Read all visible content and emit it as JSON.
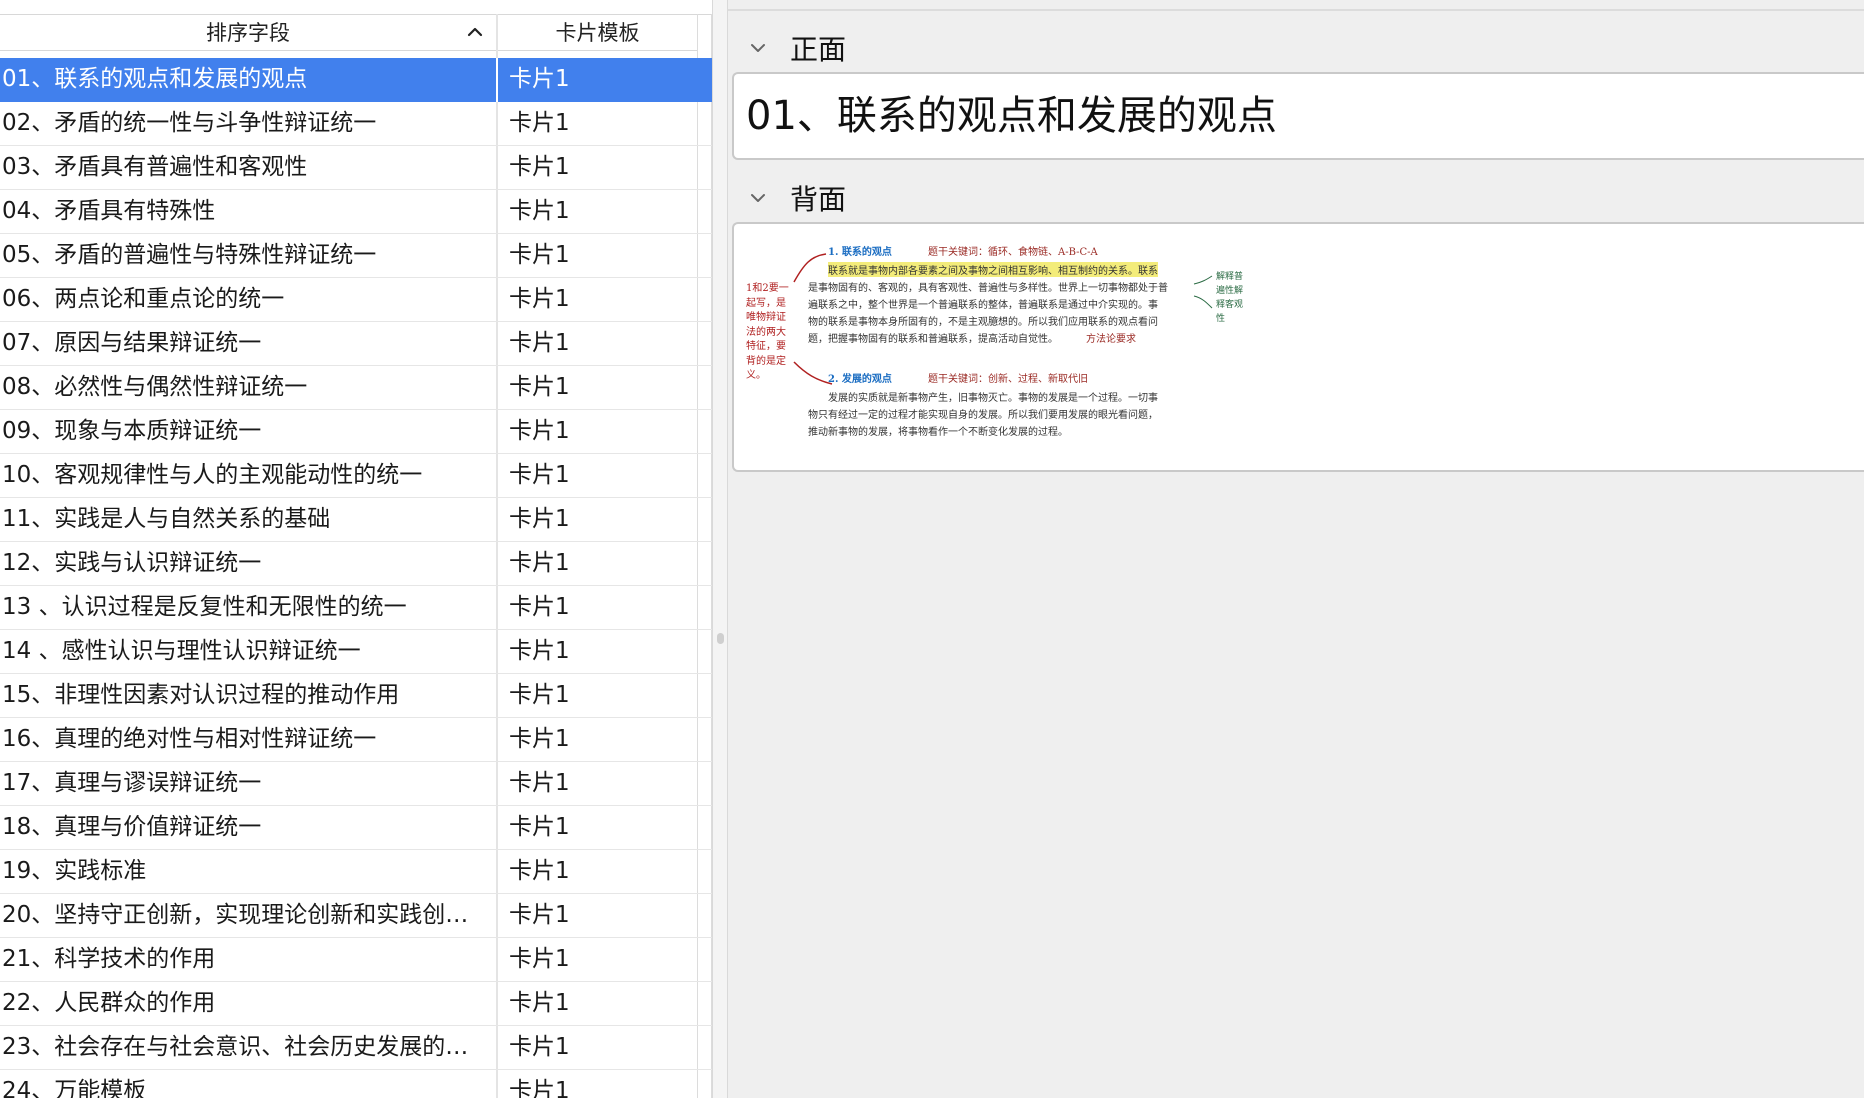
{
  "table": {
    "headers": {
      "sort_field": "排序字段",
      "card_template": "卡片模板"
    },
    "selected_index": 0,
    "rows": [
      {
        "title": "01、联系的观点和发展的观点",
        "template": "卡片1"
      },
      {
        "title": "02、矛盾的统一性与斗争性辩证统一",
        "template": "卡片1"
      },
      {
        "title": "03、矛盾具有普遍性和客观性",
        "template": "卡片1"
      },
      {
        "title": "04、矛盾具有特殊性",
        "template": "卡片1"
      },
      {
        "title": "05、矛盾的普遍性与特殊性辩证统一",
        "template": "卡片1"
      },
      {
        "title": "06、两点论和重点论的统一",
        "template": "卡片1"
      },
      {
        "title": "07、原因与结果辩证统一",
        "template": "卡片1"
      },
      {
        "title": "08、必然性与偶然性辩证统一",
        "template": "卡片1"
      },
      {
        "title": "09、现象与本质辩证统一",
        "template": "卡片1"
      },
      {
        "title": "10、客观规律性与人的主观能动性的统一",
        "template": "卡片1"
      },
      {
        "title": "11、实践是人与自然关系的基础",
        "template": "卡片1"
      },
      {
        "title": "12、实践与认识辩证统一",
        "template": "卡片1"
      },
      {
        "title": "13 、认识过程是反复性和无限性的统一",
        "template": "卡片1"
      },
      {
        "title": "14 、感性认识与理性认识辩证统一",
        "template": "卡片1"
      },
      {
        "title": "15、非理性因素对认识过程的推动作用",
        "template": "卡片1"
      },
      {
        "title": "16、真理的绝对性与相对性辩证统一",
        "template": "卡片1"
      },
      {
        "title": "17、真理与谬误辩证统一",
        "template": "卡片1"
      },
      {
        "title": "18、真理与价值辩证统一",
        "template": "卡片1"
      },
      {
        "title": "19、实践标准",
        "template": "卡片1"
      },
      {
        "title": "20、坚持守正创新，实现理论创新和实践创…",
        "template": "卡片1"
      },
      {
        "title": "21、科学技术的作用",
        "template": "卡片1"
      },
      {
        "title": "22、人民群众的作用",
        "template": "卡片1"
      },
      {
        "title": "23、社会存在与社会意识、社会历史发展的…",
        "template": "卡片1"
      },
      {
        "title": "24、万能模板",
        "template": "卡片1"
      }
    ]
  },
  "editor": {
    "front_label": "正面",
    "front_text": "01、联系的观点和发展的观点",
    "back_label": "背面",
    "back_note": {
      "heading1": "1. 联系的观点",
      "keywords1": "题干关键词：循环、食物链、A-B-C-A",
      "lines1": [
        "联系就是事物内部各要素之间及事物之间相互影响、相互制约的关系。联系",
        "是事物固有的、客观的，具有客观性、普遍性与多样性。世界上一切事物都处于普",
        "遍联系之中，整个世界是一个普遍联系的整体，普遍联系是通过中介实现的。事",
        "物的联系是事物本身所固有的，不是主观臆想的。所以我们应用联系的观点看问",
        "题，把握事物固有的联系和普遍联系，提高活动自觉性。"
      ],
      "method_tag": "方法论要求",
      "side_note": "1和2要一起写，是唯物辩证法的两大特征，要背的是定义。",
      "right_note": "解释普遍性解释客观性",
      "heading2": "2. 发展的观点",
      "keywords2": "题干关键词：创新、过程、新取代旧",
      "lines2": [
        "发展的实质就是新事物产生，旧事物灭亡。事物的发展是一个过程。一切事",
        "物只有经过一定的过程才能实现自身的发展。所以我们要用发展的眼光看问题，",
        "推动新事物的发展，将事物看作一个不断变化发展的过程。"
      ]
    }
  },
  "colors": {
    "selection": "#4180ed",
    "editor_bg": "#efefef",
    "highlight": "#f3ec7a",
    "note_heading": "#1b6dc2",
    "note_red": "#9a2a24"
  }
}
